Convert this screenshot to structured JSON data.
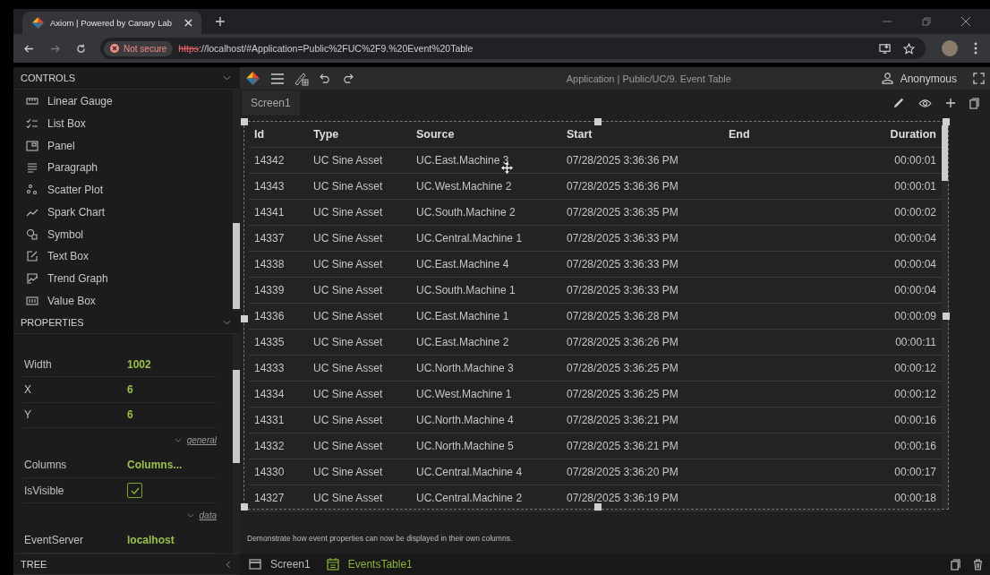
{
  "browser": {
    "tab_title": "Axiom | Powered by Canary Lab",
    "security": "Not secure",
    "url_scheme": "https",
    "url_rest": "://localhost/#Application=Public%2FUC%2F9.%20Event%20Table"
  },
  "controls": {
    "title": "CONTROLS",
    "items": [
      {
        "label": "Linear Gauge"
      },
      {
        "label": "List Box"
      },
      {
        "label": "Panel"
      },
      {
        "label": "Paragraph"
      },
      {
        "label": "Scatter Plot"
      },
      {
        "label": "Spark Chart"
      },
      {
        "label": "Symbol"
      },
      {
        "label": "Text Box"
      },
      {
        "label": "Trend Graph"
      },
      {
        "label": "Value Box"
      }
    ]
  },
  "properties": {
    "title": "PROPERTIES",
    "rows": [
      {
        "kind": "value",
        "name": "Width",
        "value": "1002"
      },
      {
        "kind": "value",
        "name": "X",
        "value": "6"
      },
      {
        "kind": "value",
        "name": "Y",
        "value": "6"
      },
      {
        "kind": "section",
        "name": "general"
      },
      {
        "kind": "value",
        "name": "Columns",
        "value": "Columns..."
      },
      {
        "kind": "checkbox",
        "name": "IsVisible",
        "checked": true
      },
      {
        "kind": "section",
        "name": "data"
      },
      {
        "kind": "value",
        "name": "EventServer",
        "value": "localhost"
      }
    ]
  },
  "tree": {
    "title": "TREE"
  },
  "app_title": "Application | Public/UC/9. Event Table",
  "user": "Anonymous",
  "screen_tabs": [
    {
      "label": "Screen1",
      "selected": true
    }
  ],
  "table": {
    "columns": [
      "Id",
      "Type",
      "Source",
      "Start",
      "End",
      "Duration"
    ],
    "rows": [
      [
        "14342",
        "UC Sine Asset",
        "UC.East.Machine 3",
        "07/28/2025 3:36:36 PM",
        "",
        "00:00:01"
      ],
      [
        "14343",
        "UC Sine Asset",
        "UC.West.Machine 2",
        "07/28/2025 3:36:36 PM",
        "",
        "00:00:01"
      ],
      [
        "14341",
        "UC Sine Asset",
        "UC.South.Machine 2",
        "07/28/2025 3:36:35 PM",
        "",
        "00:00:02"
      ],
      [
        "14337",
        "UC Sine Asset",
        "UC.Central.Machine 1",
        "07/28/2025 3:36:33 PM",
        "",
        "00:00:04"
      ],
      [
        "14338",
        "UC Sine Asset",
        "UC.East.Machine 4",
        "07/28/2025 3:36:33 PM",
        "",
        "00:00:04"
      ],
      [
        "14339",
        "UC Sine Asset",
        "UC.South.Machine 1",
        "07/28/2025 3:36:33 PM",
        "",
        "00:00:04"
      ],
      [
        "14336",
        "UC Sine Asset",
        "UC.East.Machine 1",
        "07/28/2025 3:36:28 PM",
        "",
        "00:00:09"
      ],
      [
        "14335",
        "UC Sine Asset",
        "UC.East.Machine 2",
        "07/28/2025 3:36:26 PM",
        "",
        "00:00:11"
      ],
      [
        "14333",
        "UC Sine Asset",
        "UC.North.Machine 3",
        "07/28/2025 3:36:25 PM",
        "",
        "00:00:12"
      ],
      [
        "14334",
        "UC Sine Asset",
        "UC.West.Machine 1",
        "07/28/2025 3:36:25 PM",
        "",
        "00:00:12"
      ],
      [
        "14331",
        "UC Sine Asset",
        "UC.North.Machine 4",
        "07/28/2025 3:36:21 PM",
        "",
        "00:00:16"
      ],
      [
        "14332",
        "UC Sine Asset",
        "UC.North.Machine 5",
        "07/28/2025 3:36:21 PM",
        "",
        "00:00:16"
      ],
      [
        "14330",
        "UC Sine Asset",
        "UC.Central.Machine 4",
        "07/28/2025 3:36:20 PM",
        "",
        "00:00:17"
      ],
      [
        "14327",
        "UC Sine Asset",
        "UC.Central.Machine 2",
        "07/28/2025 3:36:19 PM",
        "",
        "00:00:18"
      ]
    ]
  },
  "description": "Demonstrate how event properties can now be displayed in their own columns.",
  "breadcrumb": [
    {
      "label": "Screen1",
      "kind": "screen",
      "selected": false
    },
    {
      "label": "EventsTable1",
      "kind": "table",
      "selected": true
    }
  ]
}
